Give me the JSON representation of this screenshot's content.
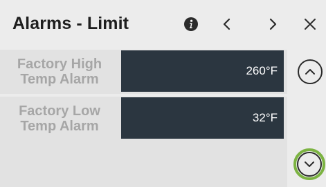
{
  "header": {
    "title": "Alarms - Limit",
    "icons": [
      "info-icon",
      "chevron-left-icon",
      "chevron-right-icon",
      "close-icon"
    ]
  },
  "settings": [
    {
      "label_line1": "Factory High",
      "label_line2": "Temp Alarm",
      "value": "260°F"
    },
    {
      "label_line1": "Factory Low",
      "label_line2": "Temp Alarm",
      "value": "32°F"
    }
  ],
  "scroll": {
    "icons": [
      "chevron-up-icon",
      "chevron-down-icon"
    ],
    "highlight_color": "#7cb342"
  },
  "colors": {
    "background": "#ececec",
    "row_background": "#e2e2e2",
    "value_field": "#2b3640",
    "label_text": "#a6a6a6",
    "title_text": "#1e1e1e"
  }
}
